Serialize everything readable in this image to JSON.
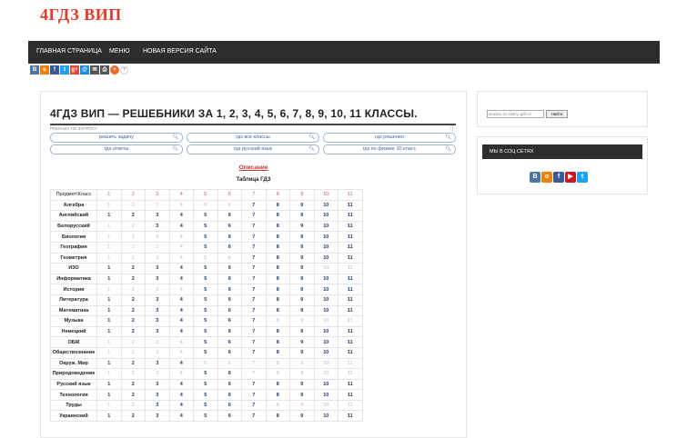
{
  "site": {
    "logo": "4ГДЗ ВИП"
  },
  "nav": {
    "items": [
      "ГЛАВНАЯ СТРАНИЦА",
      "МЕНЮ",
      "НОВАЯ ВЕРСИЯ САЙТА"
    ]
  },
  "social_bar": [
    {
      "icon": "vk-icon",
      "glyph": "В",
      "color": "#4c75a3"
    },
    {
      "icon": "ok-icon",
      "glyph": "о",
      "color": "#ee8208"
    },
    {
      "icon": "facebook-icon",
      "glyph": "f",
      "color": "#3b5998"
    },
    {
      "icon": "twitter-icon",
      "glyph": "t",
      "color": "#1da1f2"
    },
    {
      "icon": "googleplus-icon",
      "glyph": "g+",
      "color": "#dd4b39"
    },
    {
      "icon": "mailru-icon",
      "glyph": "@",
      "color": "#168de2"
    },
    {
      "icon": "email-icon",
      "glyph": "✉",
      "color": "#555555"
    },
    {
      "icon": "print-icon",
      "glyph": "⎙",
      "color": "#555555"
    },
    {
      "icon": "more-icon",
      "glyph": "+",
      "color": "#ef6a2c"
    },
    {
      "icon": "help-icon",
      "glyph": "?",
      "color": "#999999"
    }
  ],
  "main": {
    "title": "4ГДЗ ВИП — РЕШЕБНИКИ ЗА 1, 2, 3, 4, 5, 6, 7, 8, 9, 10, 11 КЛАССЫ.",
    "ad_label": "РЕКЛАМА ПО ЗАПРОСУ",
    "ad_info": "ⓘ",
    "ad_pills": [
      "решить задачу",
      "гдз все классы",
      "гдз решения",
      "гдз ответы",
      "гдз русский язык",
      "гдз по физике 10 класс"
    ],
    "description_link": "Описание",
    "table_caption": "Таблица ГДЗ",
    "table": {
      "header": [
        "Предмет\\Класс",
        "1",
        "2",
        "3",
        "4",
        "5",
        "6",
        "7",
        "8",
        "9",
        "10",
        "11"
      ],
      "rows": [
        {
          "subject": "Алгебра",
          "active": [
            0,
            0,
            0,
            0,
            0,
            0,
            1,
            1,
            1,
            1,
            1
          ]
        },
        {
          "subject": "Английский",
          "active": [
            1,
            1,
            1,
            1,
            1,
            1,
            1,
            1,
            1,
            1,
            1
          ]
        },
        {
          "subject": "Белорусский",
          "active": [
            0,
            0,
            1,
            1,
            1,
            1,
            1,
            1,
            1,
            1,
            1
          ]
        },
        {
          "subject": "Биология",
          "active": [
            0,
            0,
            0,
            0,
            1,
            1,
            1,
            1,
            1,
            1,
            1
          ]
        },
        {
          "subject": "География",
          "active": [
            0,
            0,
            0,
            0,
            1,
            1,
            1,
            1,
            1,
            1,
            1
          ]
        },
        {
          "subject": "Геометрия",
          "active": [
            0,
            0,
            0,
            0,
            0,
            0,
            1,
            1,
            1,
            1,
            1
          ]
        },
        {
          "subject": "ИЗО",
          "active": [
            1,
            1,
            1,
            1,
            1,
            1,
            1,
            1,
            1,
            0,
            0
          ]
        },
        {
          "subject": "Информатика",
          "active": [
            1,
            1,
            1,
            1,
            1,
            1,
            1,
            1,
            1,
            1,
            1
          ]
        },
        {
          "subject": "История",
          "active": [
            0,
            0,
            0,
            0,
            1,
            1,
            1,
            1,
            1,
            1,
            1
          ]
        },
        {
          "subject": "Литература",
          "active": [
            1,
            1,
            1,
            1,
            1,
            1,
            1,
            1,
            1,
            1,
            1
          ]
        },
        {
          "subject": "Математика",
          "active": [
            1,
            1,
            1,
            1,
            1,
            1,
            1,
            1,
            1,
            1,
            1
          ]
        },
        {
          "subject": "Музыка",
          "active": [
            1,
            1,
            1,
            1,
            1,
            1,
            1,
            0,
            0,
            0,
            0
          ]
        },
        {
          "subject": "Немецкий",
          "active": [
            1,
            1,
            1,
            1,
            1,
            1,
            1,
            1,
            1,
            1,
            1
          ]
        },
        {
          "subject": "ОБЖ",
          "active": [
            0,
            0,
            0,
            0,
            1,
            1,
            1,
            1,
            1,
            1,
            1
          ]
        },
        {
          "subject": "Обществознание",
          "active": [
            0,
            0,
            0,
            0,
            1,
            1,
            1,
            1,
            1,
            1,
            1
          ]
        },
        {
          "subject": "Окруж. Мир",
          "active": [
            1,
            1,
            1,
            1,
            0,
            0,
            0,
            0,
            0,
            0,
            0
          ]
        },
        {
          "subject": "Природоведение",
          "active": [
            0,
            0,
            0,
            0,
            1,
            1,
            0,
            0,
            0,
            0,
            0
          ]
        },
        {
          "subject": "Русский язык",
          "active": [
            1,
            1,
            1,
            1,
            1,
            1,
            1,
            1,
            1,
            1,
            1
          ]
        },
        {
          "subject": "Технология",
          "active": [
            1,
            1,
            1,
            1,
            1,
            1,
            1,
            1,
            1,
            1,
            1
          ]
        },
        {
          "subject": "Труды",
          "active": [
            0,
            0,
            1,
            1,
            1,
            1,
            1,
            0,
            0,
            0,
            0
          ]
        },
        {
          "subject": "Украинский",
          "active": [
            1,
            1,
            1,
            1,
            1,
            1,
            1,
            1,
            1,
            1,
            1
          ]
        }
      ]
    }
  },
  "sidebar": {
    "search_placeholder": "Искать по сайту gdz-vi",
    "search_button": "Найти",
    "social_title": "МЫ В СОЦ СЕТЯХ",
    "social_icons": [
      {
        "icon": "vk-icon",
        "glyph": "В",
        "color": "#4c75a3"
      },
      {
        "icon": "ok-icon",
        "glyph": "о",
        "color": "#ee8208"
      },
      {
        "icon": "facebook-icon",
        "glyph": "f",
        "color": "#3b5998"
      },
      {
        "icon": "youtube-icon",
        "glyph": "▶",
        "color": "#cc181e"
      },
      {
        "icon": "twitter-icon",
        "glyph": "t",
        "color": "#1da1f2"
      }
    ]
  }
}
